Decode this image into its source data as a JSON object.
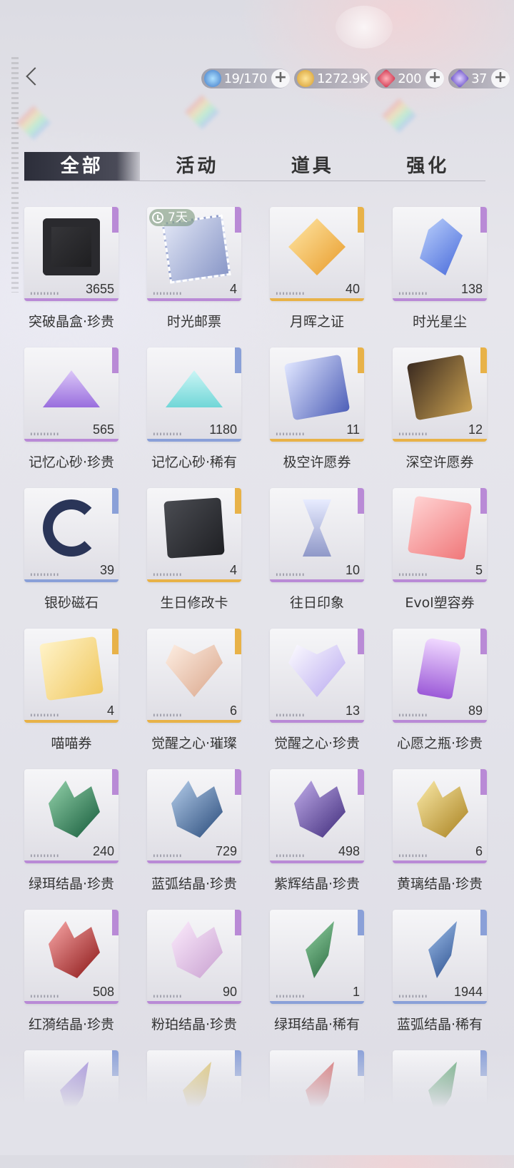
{
  "colors": {
    "rare_blue": "#8aa0d8",
    "precious_purple": "#b98ad6",
    "radiant_gold": "#e8b248"
  },
  "header": {
    "back_icon": "back-chevron-icon",
    "currencies": [
      {
        "icon": "stamina-bolt-icon",
        "value": "19/170"
      },
      {
        "icon": "gold-coin-icon",
        "value": "1272.9K"
      },
      {
        "icon": "red-diamond-icon",
        "value": "200"
      },
      {
        "icon": "purple-diamond-icon",
        "value": "37"
      }
    ],
    "plus": "+"
  },
  "tabs": [
    {
      "label": "全部",
      "active": true
    },
    {
      "label": "活动",
      "active": false
    },
    {
      "label": "道具",
      "active": false
    },
    {
      "label": "强化",
      "active": false
    }
  ],
  "items": [
    {
      "name": "突破晶盒·珍贵",
      "count": "3655",
      "rarity": "precious",
      "icon": "crystal-box-icon"
    },
    {
      "name": "时光邮票",
      "count": "4",
      "rarity": "precious",
      "icon": "stamp-icon",
      "badge": "7天"
    },
    {
      "name": "月晖之证",
      "count": "40",
      "rarity": "radiant",
      "icon": "moon-medal-icon"
    },
    {
      "name": "时光星尘",
      "count": "138",
      "rarity": "precious",
      "icon": "stardust-crystal-icon"
    },
    {
      "name": "记忆心砂·珍贵",
      "count": "565",
      "rarity": "precious",
      "icon": "purple-sand-icon"
    },
    {
      "name": "记忆心砂·稀有",
      "count": "1180",
      "rarity": "rare",
      "icon": "blue-sand-icon"
    },
    {
      "name": "极空许愿券",
      "count": "11",
      "rarity": "radiant",
      "icon": "wish-ticket-icon"
    },
    {
      "name": "深空许愿券",
      "count": "12",
      "rarity": "radiant",
      "icon": "star-ticket-icon"
    },
    {
      "name": "银砂磁石",
      "count": "39",
      "rarity": "rare",
      "icon": "magnet-icon"
    },
    {
      "name": "生日修改卡",
      "count": "4",
      "rarity": "radiant",
      "icon": "birthday-card-icon"
    },
    {
      "name": "往日印象",
      "count": "10",
      "rarity": "precious",
      "icon": "hourglass-icon"
    },
    {
      "name": "Evol塑容券",
      "count": "5",
      "rarity": "precious",
      "icon": "evol-ticket-icon"
    },
    {
      "name": "喵喵券",
      "count": "4",
      "rarity": "radiant",
      "icon": "cat-ticket-icon"
    },
    {
      "name": "觉醒之心·璀璨",
      "count": "6",
      "rarity": "radiant",
      "icon": "gold-heart-gem-icon"
    },
    {
      "name": "觉醒之心·珍贵",
      "count": "13",
      "rarity": "precious",
      "icon": "purple-heart-gem-icon"
    },
    {
      "name": "心愿之瓶·珍贵",
      "count": "89",
      "rarity": "precious",
      "icon": "wish-bottle-icon"
    },
    {
      "name": "绿珥结晶·珍贵",
      "count": "240",
      "rarity": "precious",
      "icon": "green-crystal-icon"
    },
    {
      "name": "蓝弧结晶·珍贵",
      "count": "729",
      "rarity": "precious",
      "icon": "blue-crystal-icon"
    },
    {
      "name": "紫辉结晶·珍贵",
      "count": "498",
      "rarity": "precious",
      "icon": "purple-crystal-icon"
    },
    {
      "name": "黄璃结晶·珍贵",
      "count": "6",
      "rarity": "precious",
      "icon": "yellow-crystal-icon"
    },
    {
      "name": "红漪结晶·珍贵",
      "count": "508",
      "rarity": "precious",
      "icon": "red-crystal-icon"
    },
    {
      "name": "粉珀结晶·珍贵",
      "count": "90",
      "rarity": "precious",
      "icon": "pink-crystal-icon"
    },
    {
      "name": "绿珥结晶·稀有",
      "count": "1",
      "rarity": "rare",
      "icon": "small-green-crystal-icon"
    },
    {
      "name": "蓝弧结晶·稀有",
      "count": "1944",
      "rarity": "rare",
      "icon": "small-blue-crystal-icon"
    },
    {
      "name": "",
      "count": "",
      "rarity": "rare",
      "icon": "small-purple-crystal-icon"
    },
    {
      "name": "",
      "count": "",
      "rarity": "rare",
      "icon": "small-yellow-crystal-icon"
    },
    {
      "name": "",
      "count": "",
      "rarity": "rare",
      "icon": "small-red-crystal-icon"
    },
    {
      "name": "",
      "count": "",
      "rarity": "rare",
      "icon": "small-green-crystal-icon"
    }
  ]
}
